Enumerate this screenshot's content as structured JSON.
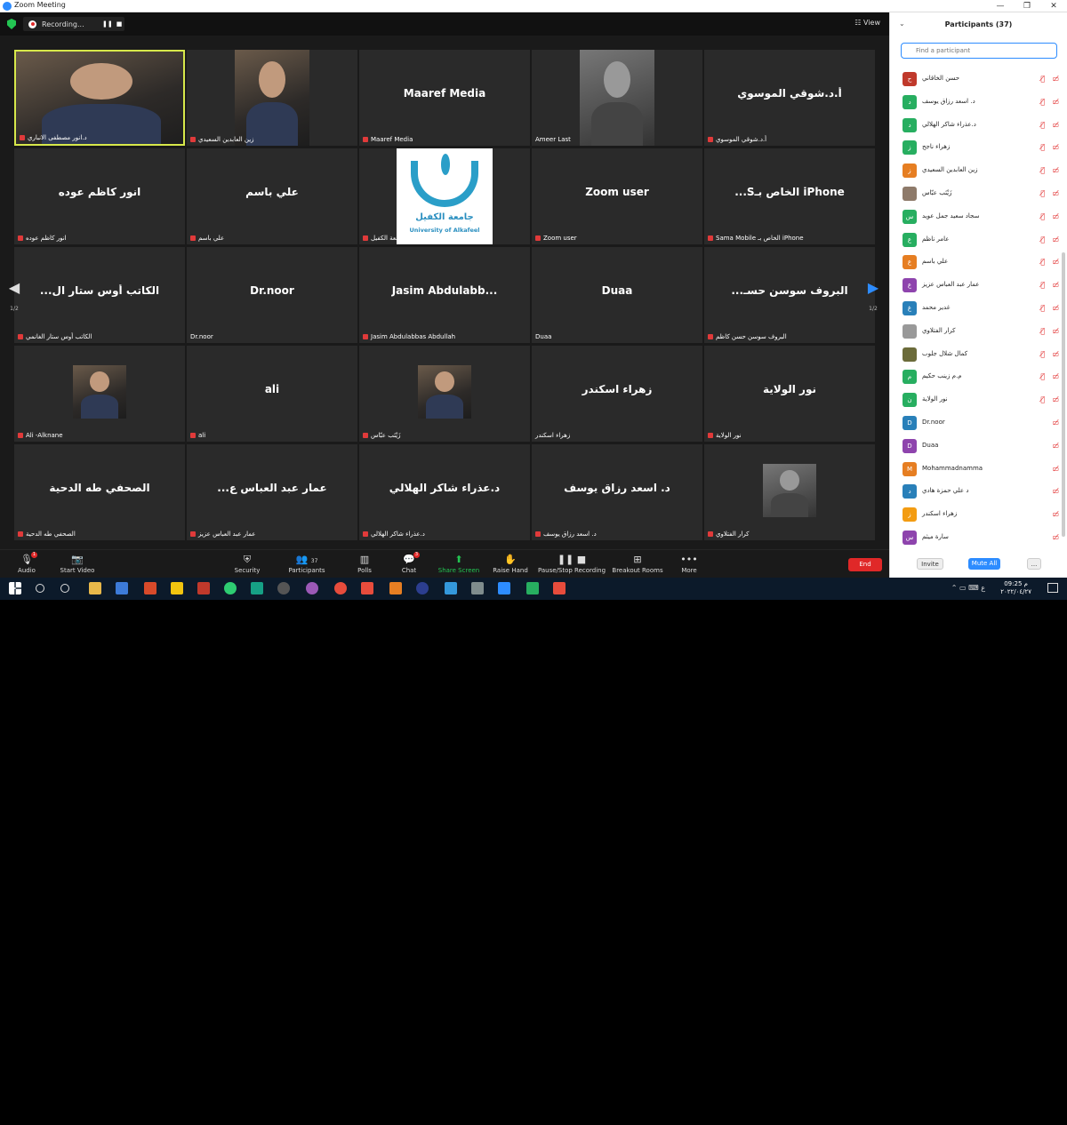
{
  "window": {
    "title": "Zoom Meeting",
    "minimize": "—",
    "maximize": "❐",
    "close": "✕"
  },
  "topbar": {
    "recording_label": "Recording...",
    "pause": "❚❚",
    "stop": "■",
    "view_label": "View"
  },
  "tiles": [
    {
      "big": "",
      "name": "د.انور مصطفى الانباري",
      "photo": true,
      "active": true,
      "icon": "mic"
    },
    {
      "big": "",
      "name": "زين العابدين السعيدي",
      "photo": true,
      "icon": "mic"
    },
    {
      "big": "Maaref Media",
      "name": "Maaref Media"
    },
    {
      "big": "",
      "name": "Ameer Last",
      "photo": true,
      "gray": true,
      "icon": "none"
    },
    {
      "big": "أ.د.شوقي الموسوي",
      "name": "أ.د.شوقي الموسوي"
    },
    {
      "big": "انور كاظم عوده",
      "name": "انور كاظم عوده"
    },
    {
      "big": "علي باسم",
      "name": "علي باسم"
    },
    {
      "big": "",
      "name": "جامعة الكفيل",
      "logo": true
    },
    {
      "big": "Zoom user",
      "name": "Zoom user"
    },
    {
      "big": "...Sالخاص بـ iPhone",
      "name": "Sama Mobile الخاص بـ iPhone"
    },
    {
      "big": "...الكاتب أوس ستار ال",
      "name": "الكاتب أوس ستار الغانمي"
    },
    {
      "big": "Dr.noor",
      "name": "Dr.noor",
      "icon": "none"
    },
    {
      "big": "Jasim Abdulabb...",
      "name": "Jasim Abdulabbas Abdullah"
    },
    {
      "big": "Duaa",
      "name": "Duaa",
      "icon": "none"
    },
    {
      "big": "...البروف سوسن حسـ",
      "name": "البروف سوسن حسن كاظم"
    },
    {
      "big": "",
      "name": "Ali -Alknane",
      "photo": true,
      "small": true
    },
    {
      "big": "ali",
      "name": "ali"
    },
    {
      "big": "",
      "name": "زَيْنَب عبّاس",
      "photo": true,
      "small": true
    },
    {
      "big": "زهراء اسكندر",
      "name": "زهراء اسكندر",
      "icon": "none"
    },
    {
      "big": "نور الولاية",
      "name": "نور الولاية"
    },
    {
      "big": "الصحفي طه الدحية",
      "name": "الصحفي طه الدحية"
    },
    {
      "big": "...عمار عبد العباس ع",
      "name": "عمار عبد العباس عزيز"
    },
    {
      "big": "د.عذراء شاكر الهلالي",
      "name": "د.عذراء شاكر الهلالي"
    },
    {
      "big": "د. اسعد رزاق يوسف",
      "name": "د. اسعد رزاق يوسف"
    },
    {
      "big": "",
      "name": "كرار الفتلاوي",
      "photo": true,
      "small": true,
      "gray": true
    }
  ],
  "logo": {
    "arabic": "جامعة الكفيل",
    "english": "University of Alkafeel"
  },
  "pager": {
    "left_page": "1/2",
    "right_page": "1/2",
    "left_arrow": "◀",
    "right_arrow": "▶"
  },
  "toolbar": {
    "audio": "Audio",
    "start_video": "Start Video",
    "security": "Security",
    "participants": "Participants",
    "participants_count": "37",
    "polls": "Polls",
    "chat": "Chat",
    "chat_badge": "3",
    "share_screen": "Share Screen",
    "raise_hand": "Raise Hand",
    "record": "Pause/Stop Recording",
    "breakout": "Breakout Rooms",
    "more": "More",
    "end": "End",
    "audio_badge": "1"
  },
  "panel": {
    "title": "Participants (37)",
    "search_placeholder": "Find a participant",
    "participants": [
      {
        "name": "حسن الخاقاني",
        "initial": "ح",
        "color": "#c0392b",
        "mic": "off"
      },
      {
        "name": "د. اسعد رزاق يوسف",
        "initial": "د",
        "color": "#27ae60",
        "mic": "off"
      },
      {
        "name": "د.عذراء شاكر الهلالي",
        "initial": "د",
        "color": "#27ae60",
        "mic": "off"
      },
      {
        "name": "زهراء ناجح",
        "initial": "ز",
        "color": "#27ae60",
        "mic": "off"
      },
      {
        "name": "زين العابدين السعيدي",
        "initial": "ز",
        "color": "#e67e22",
        "mic": "off"
      },
      {
        "name": "زَيْنَب عبّاس",
        "initial": "",
        "color": "#8e7a6a",
        "mic": "off"
      },
      {
        "name": "سجاد سعيد جمل عويد",
        "initial": "س",
        "color": "#27ae60",
        "mic": "off"
      },
      {
        "name": "عامر ناظم",
        "initial": "ع",
        "color": "#27ae60",
        "mic": "off"
      },
      {
        "name": "علي باسم",
        "initial": "ع",
        "color": "#e67e22",
        "mic": "off"
      },
      {
        "name": "عمار عبد العباس عزيز",
        "initial": "ع",
        "color": "#8e44ad",
        "mic": "off"
      },
      {
        "name": "غدير محمد",
        "initial": "غ",
        "color": "#2980b9",
        "mic": "off"
      },
      {
        "name": "كرار الفتلاوي",
        "initial": "",
        "color": "#999999",
        "mic": "off"
      },
      {
        "name": "كمال شلال جلوب",
        "initial": "",
        "color": "#6b6b3a",
        "mic": "off"
      },
      {
        "name": "م.م زينب حكيم",
        "initial": "م",
        "color": "#27ae60",
        "mic": "off"
      },
      {
        "name": "نور الولاية",
        "initial": "ن",
        "color": "#27ae60",
        "mic": "off"
      },
      {
        "name": "Dr.noor",
        "initial": "D",
        "color": "#2980b9",
        "mic": "none"
      },
      {
        "name": "Duaa",
        "initial": "D",
        "color": "#8e44ad",
        "mic": "none"
      },
      {
        "name": "Mohammadnamma",
        "initial": "M",
        "color": "#e67e22",
        "mic": "none"
      },
      {
        "name": "د علي حمزة هادي",
        "initial": "د",
        "color": "#2980b9",
        "mic": "none"
      },
      {
        "name": "زهراء اسكندر",
        "initial": "ز",
        "color": "#f39c12",
        "mic": "none"
      },
      {
        "name": "سارة ميثم",
        "initial": "س",
        "color": "#8e44ad",
        "mic": "none"
      }
    ],
    "invite": "Invite",
    "mute_all": "Mute All",
    "more": "..."
  },
  "taskbar": {
    "time": "09:25 م",
    "date": "٢٠٢٢/٠٤/٢٧",
    "lang": "ع"
  },
  "colors": {
    "zoom_blue": "#2d8cff",
    "end_red": "#e02828",
    "active_border": "#d7e84a",
    "green": "#23c552"
  }
}
